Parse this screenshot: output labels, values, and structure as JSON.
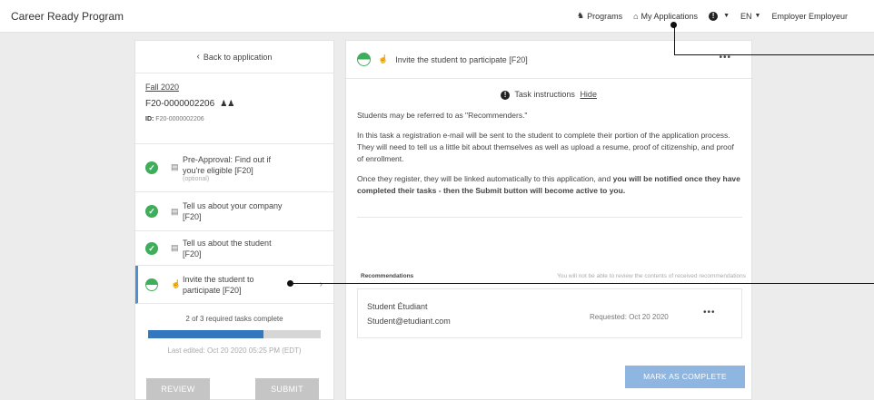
{
  "header": {
    "brand": "Career Ready Program",
    "nav": {
      "programs": "Programs",
      "my_applications": "My Applications",
      "language": "EN",
      "user": "Employer Employeur"
    }
  },
  "sidebar": {
    "back_label": "Back to application",
    "term": "Fall 2020",
    "app_number": "F20-0000002206",
    "id_label": "ID:",
    "id_value": "F20-0000002206",
    "tasks": [
      {
        "label_line1": "Pre-Approval: Find out if",
        "label_line2": "you're eligible [F20]",
        "sub": "(optional)",
        "status": "complete"
      },
      {
        "label_line1": "Tell us about your company",
        "label_line2": "[F20]",
        "status": "complete"
      },
      {
        "label_line1": "Tell us about the student",
        "label_line2": "[F20]",
        "status": "complete"
      },
      {
        "label_line1": "Invite the student to",
        "label_line2": "participate [F20]",
        "status": "in-progress"
      }
    ],
    "progress_text": "2 of 3 required tasks complete",
    "progress_fraction": 0.667,
    "last_edited": "Last edited: Oct 20 2020 05:25 PM (EDT)",
    "review_label": "REVIEW",
    "submit_label": "SUBMIT"
  },
  "main": {
    "task_title": "Invite the student to participate [F20]",
    "instructions_label": "Task instructions",
    "hide_label": "Hide",
    "para1": "Students may be referred to as \"Recommenders.\"",
    "para2": "In this task a registration e-mail will be sent to the student to complete their portion of the application process. They will need to tell us a little bit about themselves as well as upload a resume, proof of citizenship, and proof of enrollment.",
    "para3_plain": "Once they register, they will be linked automatically to this application, and ",
    "para3_bold": "you will be notified once they have completed their tasks - then the Submit button will become active to you.",
    "recommendations_label": "Recommendations",
    "recommendations_note": "You will not be able to review the contents of received recommendations",
    "recommendation": {
      "name": "Student Étudiant",
      "email": "Student@etudiant.com",
      "requested": "Requested: Oct 20 2020"
    },
    "complete_label": "MARK AS COMPLETE"
  },
  "colors": {
    "complete_green": "#3fae5b",
    "progress_blue": "#3378bf",
    "button_blue": "#8fb6e0",
    "button_grey": "#c5c5c5"
  }
}
